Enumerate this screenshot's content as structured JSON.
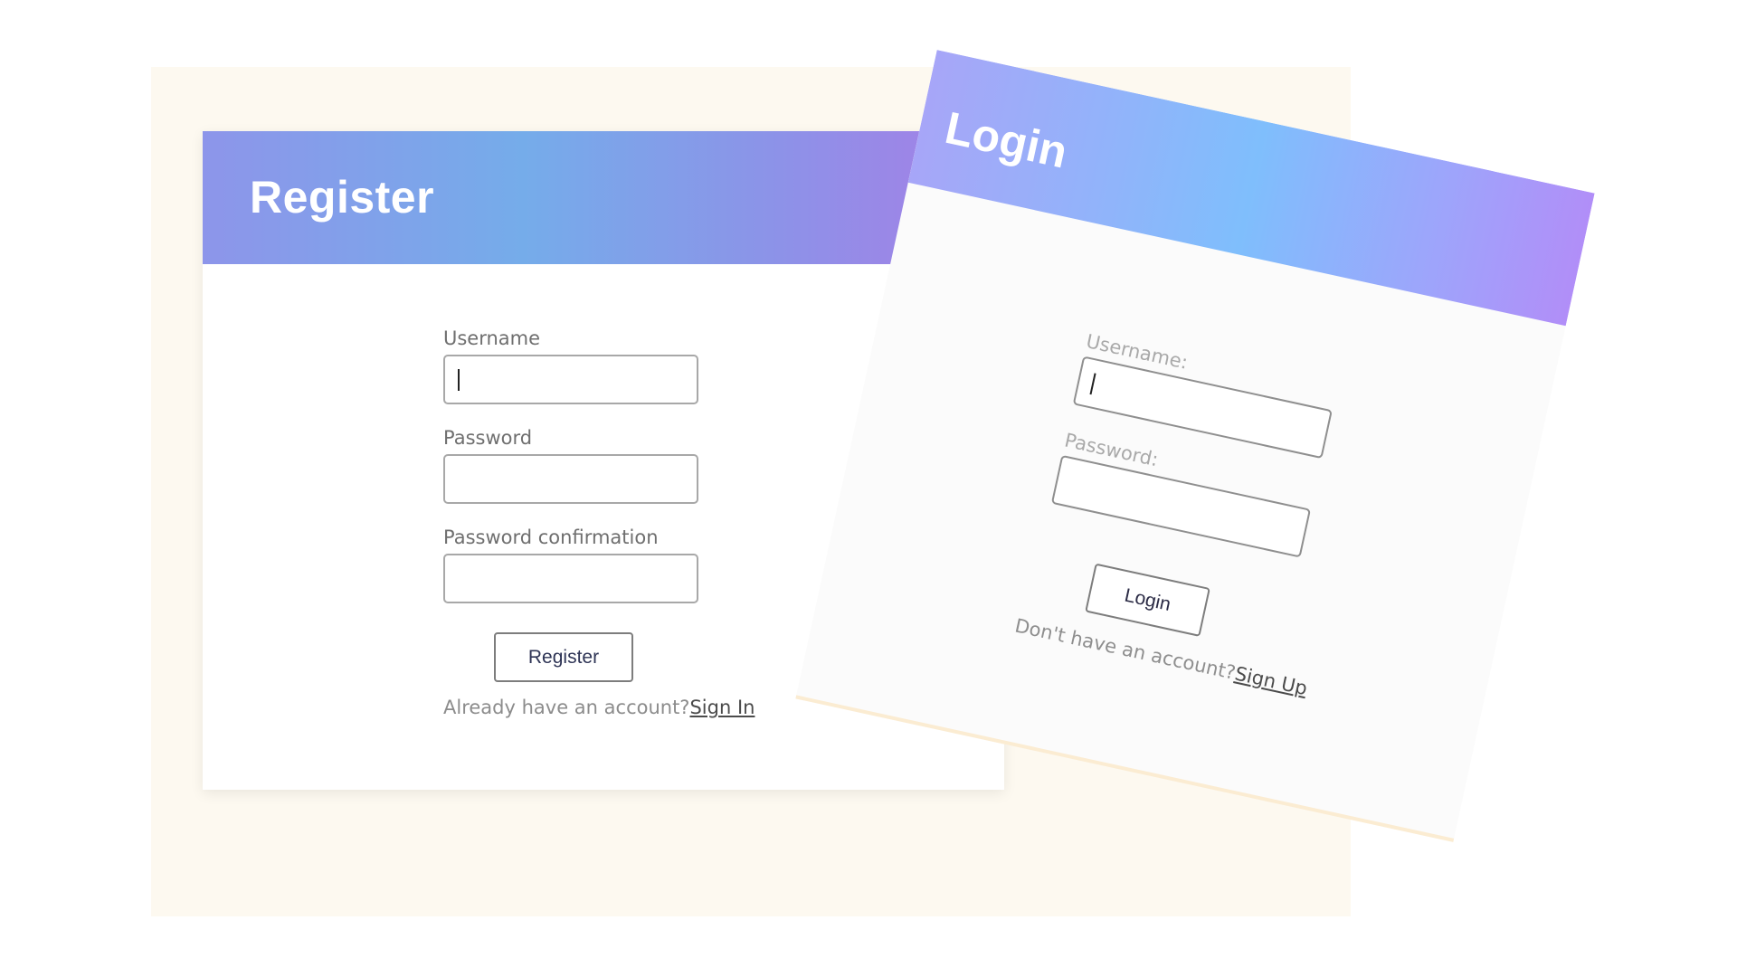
{
  "register": {
    "title": "Register",
    "username_label": "Username",
    "password_label": "Password",
    "password_confirmation_label": "Password confirmation",
    "submit_label": "Register",
    "footer_text": "Already have an account?",
    "footer_link": "Sign In",
    "header_gradient": [
      "#8d95ea",
      "#75acea",
      "#a77de6"
    ]
  },
  "login": {
    "title": "Login",
    "username_label": "Username:",
    "password_label": "Password:",
    "submit_label": "Login",
    "footer_text": "Don't have an account?",
    "footer_link": "Sign Up",
    "header_gradient": [
      "#a7a6f8",
      "#7fbefc",
      "#b18ef8"
    ]
  },
  "colors": {
    "backdrop": "#fdf9f0",
    "page": "#ffffff"
  }
}
